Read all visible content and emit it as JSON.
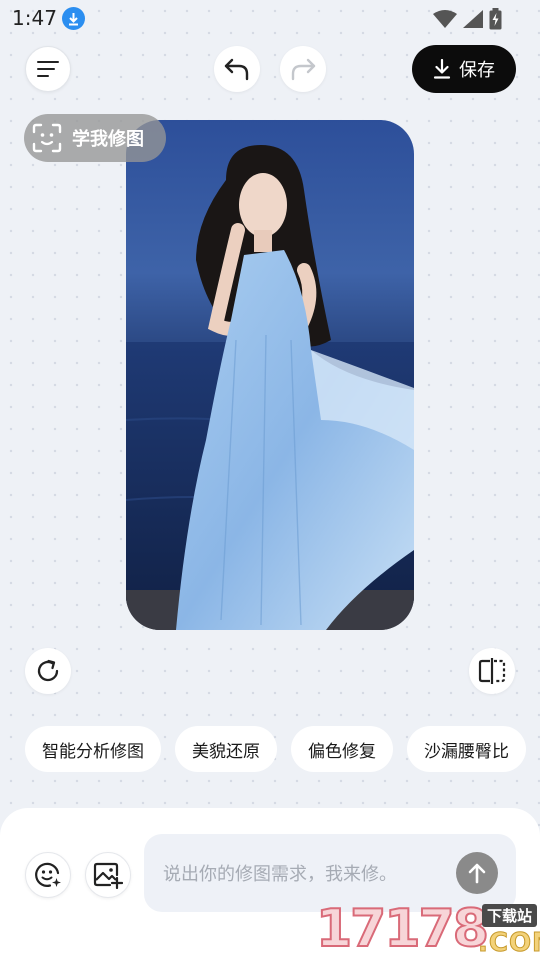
{
  "status_bar": {
    "time": "1:47",
    "download_icon": "download-arrow-icon",
    "wifi_icon": "wifi-icon",
    "signal_icon": "cell-signal-icon",
    "battery_icon": "battery-charging-icon"
  },
  "toolbar": {
    "menu_icon": "menu-lines-icon",
    "undo_icon": "undo-arrow-icon",
    "redo_icon": "redo-arrow-icon",
    "save_label": "保存"
  },
  "canvas": {
    "learn_label": "学我修图",
    "learn_icon": "face-scan-icon",
    "rotate_icon": "rotate-icon",
    "compare_icon": "compare-split-icon"
  },
  "suggestions": [
    "智能分析修图",
    "美貌还原",
    "偏色修复",
    "沙漏腰臀比"
  ],
  "composer": {
    "face_icon": "face-sparkle-icon",
    "add_image_icon": "add-image-icon",
    "placeholder": "说出你的修图需求，我来修。",
    "send_icon": "arrow-up-icon"
  },
  "watermark": {
    "number": "17178",
    "tag": "下载站",
    "suffix": ".COM"
  },
  "colors": {
    "background": "#eef1f6",
    "save_button": "#0c0c0c",
    "send_button": "#8a8a8a",
    "download_badge": "#2b8ef0"
  }
}
